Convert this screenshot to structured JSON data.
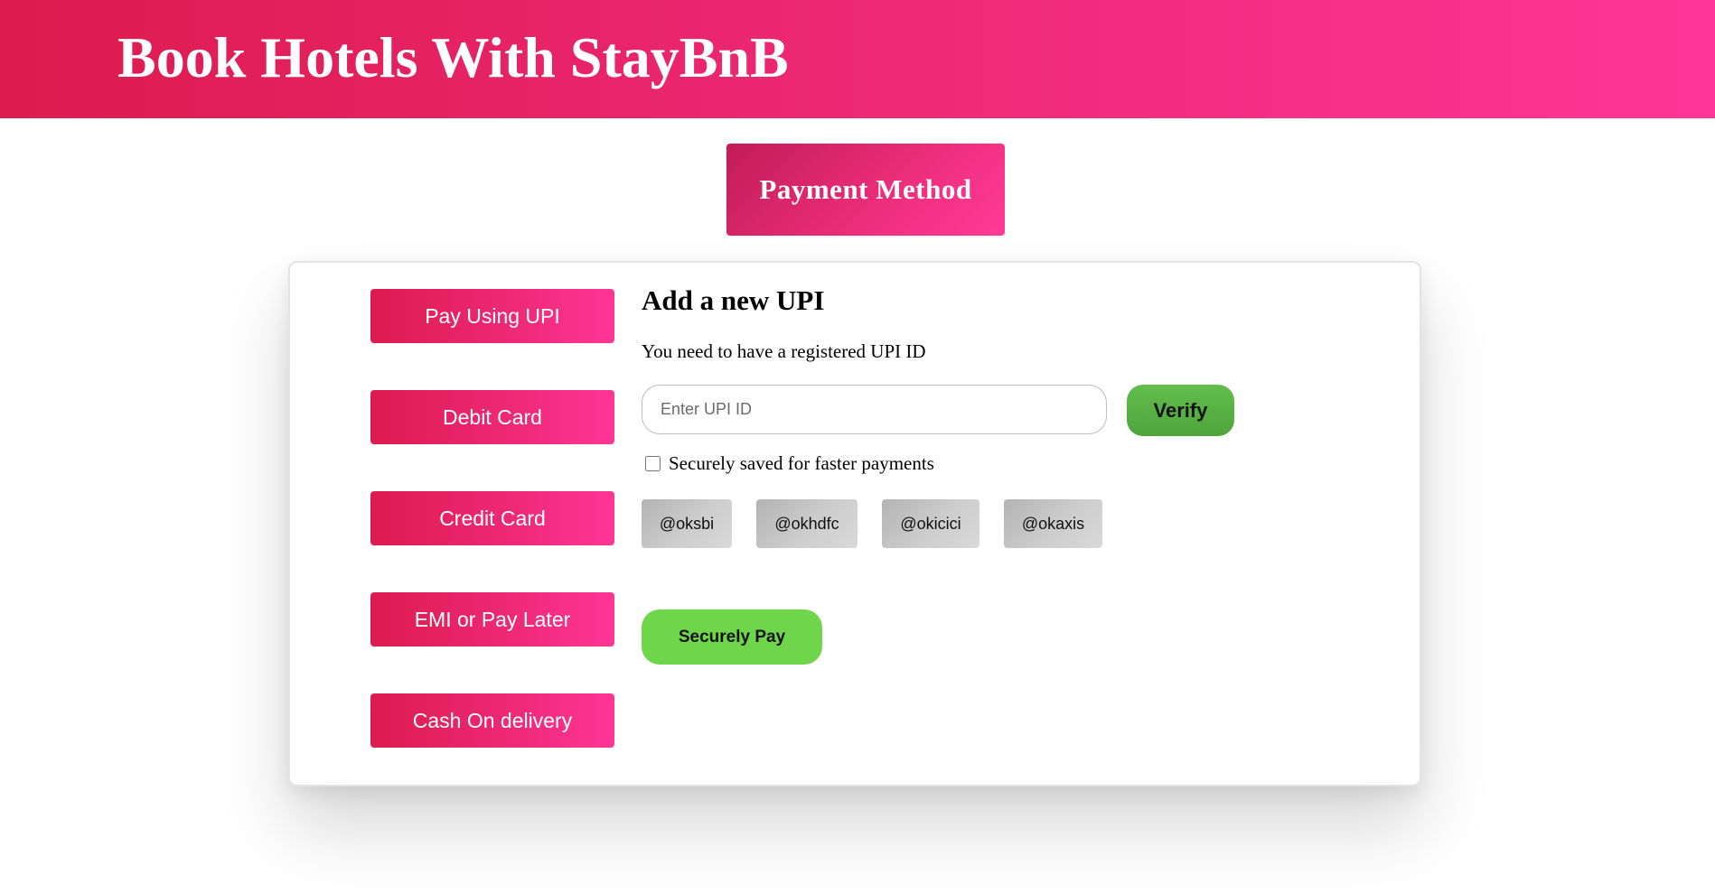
{
  "header": {
    "title": "Book Hotels With StayBnB"
  },
  "section_badge": {
    "label": "Payment Method"
  },
  "methods": [
    {
      "label": "Pay Using UPI"
    },
    {
      "label": "Debit Card"
    },
    {
      "label": "Credit Card"
    },
    {
      "label": "EMI or Pay Later"
    },
    {
      "label": "Cash On delivery"
    }
  ],
  "upi": {
    "heading": "Add a new UPI",
    "note": "You need to have a registered UPI ID",
    "input_placeholder": "Enter UPI ID",
    "input_value": "",
    "verify_label": "Verify",
    "save_label": "Securely saved for faster payments",
    "save_checked": false,
    "handles": [
      {
        "label": "@oksbi"
      },
      {
        "label": "@okhdfc"
      },
      {
        "label": "@okicici"
      },
      {
        "label": "@okaxis"
      }
    ],
    "pay_label": "Securely Pay"
  },
  "colors": {
    "brand_start": "#dc1b4e",
    "brand_end": "#ff3597",
    "verify_green": "#5cb646",
    "pay_green": "#6fd64b",
    "chip_gray": "#c8c8c8"
  }
}
